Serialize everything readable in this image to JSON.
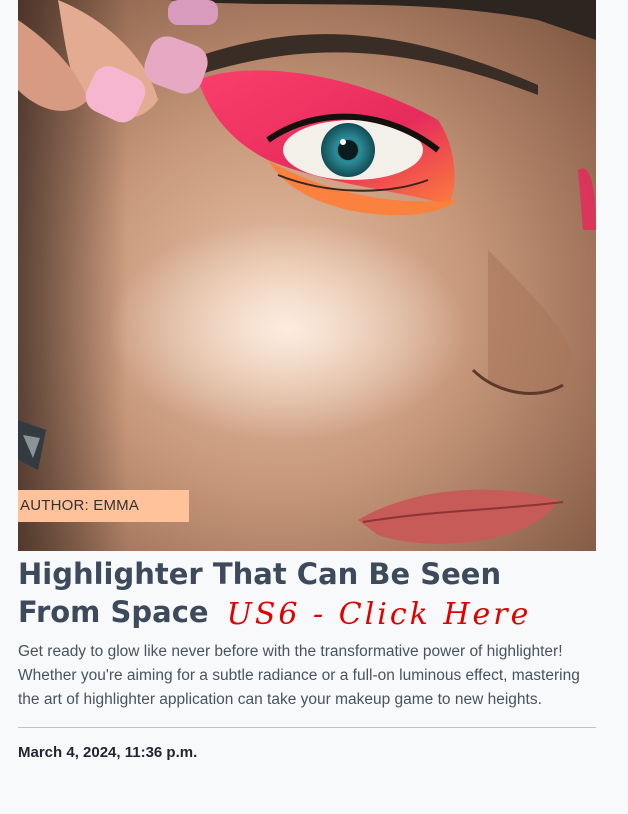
{
  "article": {
    "image_alt": "Close-up of a face with bold pink and orange eye makeup and glowing highlighter",
    "author_label": "AUTHOR: EMMA",
    "title": "Highlighter That Can Be Seen From Space",
    "annotation": "US6 - Click Here",
    "excerpt": "Get ready to glow like never before with the transformative power of highlighter! Whether you're aiming for a subtle radiance or a full-on luminous effect, mastering the art of highlighter application can take your makeup game to new heights.",
    "date": "March 4, 2024, 11:36 p.m."
  },
  "colors": {
    "page_background": "#f8f9fb",
    "title": "#3d4a5c",
    "author_badge": "#ffc29a",
    "annotation": "#e00000"
  }
}
